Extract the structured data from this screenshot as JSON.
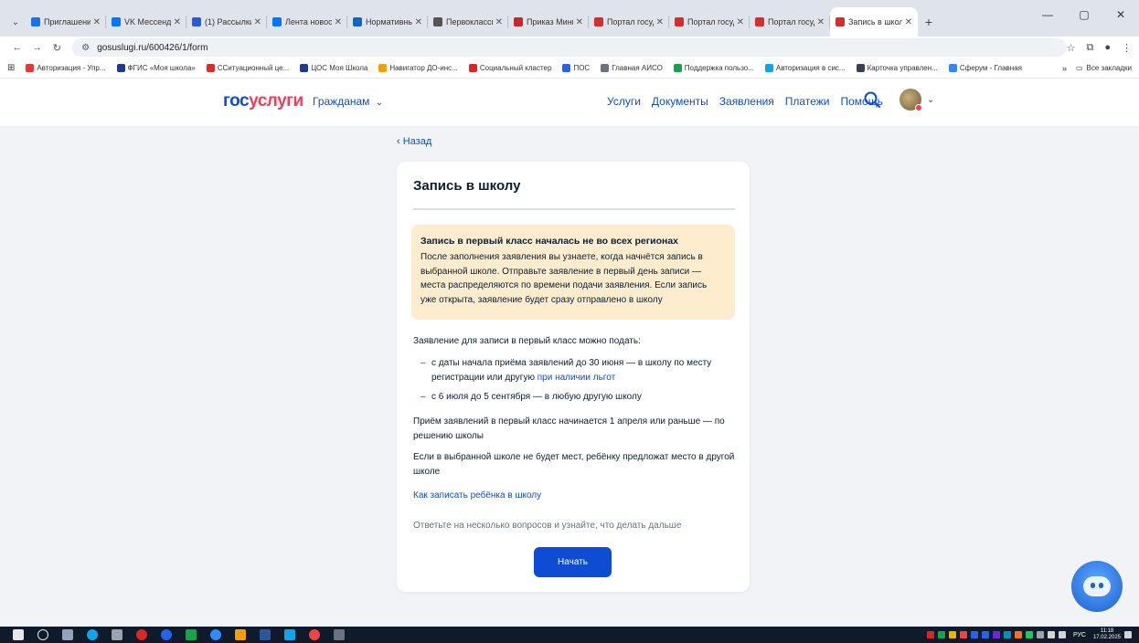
{
  "browser": {
    "tabs": [
      {
        "title": "Приглашени",
        "color": "#1a73e8"
      },
      {
        "title": "VK Мессендж",
        "color": "#0077ff"
      },
      {
        "title": "(1) Рассылки",
        "color": "#2a5bd7"
      },
      {
        "title": "Лента новост",
        "color": "#0077ff"
      },
      {
        "title": "Нормативны",
        "color": "#1565c0"
      },
      {
        "title": "Первоклассн",
        "color": "#555555"
      },
      {
        "title": "Приказ Мини",
        "color": "#c62828"
      },
      {
        "title": "Портал госуд",
        "color": "#d32f2f"
      },
      {
        "title": "Портал госуд",
        "color": "#d32f2f"
      },
      {
        "title": "Портал госуд",
        "color": "#d32f2f"
      },
      {
        "title": "Запись в школ",
        "color": "#d32f2f",
        "active": true
      }
    ],
    "url": "gosuslugi.ru/600426/1/form",
    "bookmarks": [
      {
        "label": "Авторизация - Упр...",
        "color": "#e53935"
      },
      {
        "label": "ФГИС «Моя школа»",
        "color": "#1e3a8a"
      },
      {
        "label": "ССитуационный це...",
        "color": "#d32f2f"
      },
      {
        "label": "ЦОС Моя Школа",
        "color": "#1e3a8a"
      },
      {
        "label": "Навигатор ДО-инс...",
        "color": "#f59e0b"
      },
      {
        "label": "Социальный кластер",
        "color": "#dc2626"
      },
      {
        "label": "ПОС",
        "color": "#2563eb"
      },
      {
        "label": "Главная АИСО",
        "color": "#6b7280"
      },
      {
        "label": "Поддержка пользо...",
        "color": "#16a34a"
      },
      {
        "label": "Авторизация в сис...",
        "color": "#0ea5e9"
      },
      {
        "label": "Карточка управлен...",
        "color": "#374151"
      },
      {
        "label": "Сферум - Главная",
        "color": "#3b82f6"
      }
    ],
    "bookmarks_more": "»",
    "all_bookmarks": "Все закладки"
  },
  "header": {
    "logo_part1": "гос",
    "logo_part2": "услуги",
    "audience": "Гражданам",
    "nav": [
      "Услуги",
      "Документы",
      "Заявления",
      "Платежи",
      "Помощь"
    ]
  },
  "page": {
    "back": "Назад",
    "title": "Запись в школу",
    "notice_title": "Запись в первый класс началась не во всех регионах",
    "notice_text": "После заполнения заявления вы узнаете, когда начнётся запись в выбранной школе. Отправьте заявление в первый день записи — места распределяются по времени подачи заявления. Если запись уже открыта, заявление будет сразу отправлено в школу",
    "intro": "Заявление для записи в первый класс можно подать:",
    "item1_text": "с даты начала приёма заявлений до 30 июня — в школу по месту регистрации или другую",
    "item1_link": "при наличии льгот",
    "item2_text": "с 6 июля до 5 сентября — в любую другую школу",
    "para1": "Приём заявлений в первый класс начинается 1 апреля или раньше — по решению школы",
    "para2": "Если в выбранной школе не будет мест, ребёнку предложат место в другой школе",
    "howto_link": "Как записать ребёнка в школу",
    "prompt": "Ответьте на несколько вопросов и узнайте, что делать дальше",
    "start_button": "Начать"
  },
  "taskbar": {
    "lang": "РУС",
    "time": "11:18",
    "date": "17.02.2025"
  }
}
